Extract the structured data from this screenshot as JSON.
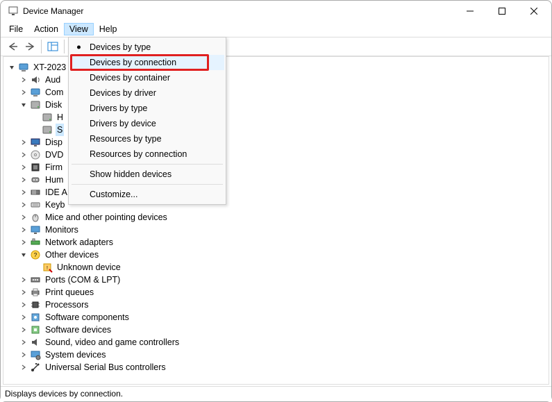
{
  "titlebar": {
    "title": "Device Manager"
  },
  "menubar": {
    "items": [
      {
        "label": "File"
      },
      {
        "label": "Action"
      },
      {
        "label": "View",
        "active": true
      },
      {
        "label": "Help"
      }
    ]
  },
  "view_menu": {
    "items": [
      {
        "label": "Devices by type",
        "checked": true
      },
      {
        "label": "Devices by connection",
        "highlighted": true,
        "redbox": true
      },
      {
        "label": "Devices by container"
      },
      {
        "label": "Devices by driver"
      },
      {
        "label": "Drivers by type"
      },
      {
        "label": "Drivers by device"
      },
      {
        "label": "Resources by type"
      },
      {
        "label": "Resources by connection"
      },
      {
        "sep": true
      },
      {
        "label": "Show hidden devices"
      },
      {
        "sep": true
      },
      {
        "label": "Customize..."
      }
    ]
  },
  "tree": {
    "root": {
      "label": "XT-2023",
      "expanded": true,
      "icon": "computer"
    },
    "categories": [
      {
        "label_trunc": "Aud",
        "icon": "audio",
        "expander": ">"
      },
      {
        "label_trunc": "Com",
        "icon": "computer",
        "expander": ">"
      },
      {
        "label_trunc": "Disk",
        "icon": "disk",
        "expander": "v",
        "children": [
          {
            "label_trunc": "H",
            "icon": "disk"
          },
          {
            "label_trunc": "S",
            "icon": "disk",
            "selected": true
          }
        ]
      },
      {
        "label_trunc": "Disp",
        "icon": "display",
        "expander": ">"
      },
      {
        "label": "DVD",
        "icon": "dvd",
        "expander": ">"
      },
      {
        "label_trunc": "Firm",
        "icon": "firmware",
        "expander": ">"
      },
      {
        "label_trunc": "Hum",
        "icon": "hid",
        "expander": ">"
      },
      {
        "label_trunc": "IDE A",
        "icon": "ide",
        "expander": ">"
      },
      {
        "label_trunc": "Keyb",
        "icon": "keyboard",
        "expander": ">"
      },
      {
        "label": "Mice and other pointing devices",
        "icon": "mouse",
        "expander": ">"
      },
      {
        "label": "Monitors",
        "icon": "monitor",
        "expander": ">"
      },
      {
        "label": "Network adapters",
        "icon": "network",
        "expander": ">"
      },
      {
        "label": "Other devices",
        "icon": "other",
        "expander": "v",
        "children": [
          {
            "label": "Unknown device",
            "icon": "unknown"
          }
        ]
      },
      {
        "label": "Ports (COM & LPT)",
        "icon": "ports",
        "expander": ">"
      },
      {
        "label": "Print queues",
        "icon": "print",
        "expander": ">"
      },
      {
        "label": "Processors",
        "icon": "cpu",
        "expander": ">"
      },
      {
        "label": "Software components",
        "icon": "swcomp",
        "expander": ">"
      },
      {
        "label": "Software devices",
        "icon": "swdev",
        "expander": ">"
      },
      {
        "label": "Sound, video and game controllers",
        "icon": "sound",
        "expander": ">"
      },
      {
        "label": "System devices",
        "icon": "system",
        "expander": ">"
      },
      {
        "label": "Universal Serial Bus controllers",
        "icon": "usb",
        "expander": ">"
      }
    ]
  },
  "statusbar": {
    "text": "Displays devices by connection."
  }
}
